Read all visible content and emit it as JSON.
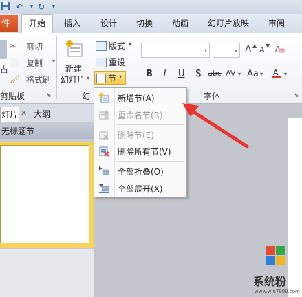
{
  "ribbon_tabs": [
    {
      "label": "件",
      "active": false
    },
    {
      "label": "开始",
      "active": true
    },
    {
      "label": "插入",
      "active": false
    },
    {
      "label": "设计",
      "active": false
    },
    {
      "label": "切换",
      "active": false
    },
    {
      "label": "动画",
      "active": false
    },
    {
      "label": "幻灯片放映",
      "active": false
    },
    {
      "label": "审阅",
      "active": false
    }
  ],
  "clipboard": {
    "cut": "剪切",
    "copy": "复制",
    "format_painter": "格式刷",
    "paste_fragment": "占",
    "group_label": "剪贴板"
  },
  "slides": {
    "new_slide_line1": "新建",
    "new_slide_line2": "幻灯片",
    "layout": "版式",
    "reset": "重设",
    "section": "节",
    "group_label_fragment": "幻"
  },
  "font": {
    "group_label": "字体",
    "bold": "B",
    "italic": "I",
    "underline": "U",
    "shadow": "S",
    "strike": "abc",
    "spacing": "AV",
    "case": "Aa",
    "grow": "A",
    "shrink": "A"
  },
  "panel": {
    "tab_slides": "灯片",
    "tab_outline": "大纲",
    "section_header": "无标题节"
  },
  "section_menu": {
    "items": [
      {
        "label": "新增节(A)",
        "enabled": true
      },
      {
        "label": "重命名节(R)",
        "enabled": false
      },
      {
        "label": "删除节(E)",
        "enabled": false
      },
      {
        "label": "删除所有节(V)",
        "enabled": true
      },
      {
        "label": "全部折叠(O)",
        "enabled": true
      },
      {
        "label": "全部展开(X)",
        "enabled": true
      }
    ]
  },
  "watermark": {
    "text": "系统粉",
    "url": "www.win7999.com"
  },
  "colors": {
    "accent_red": "#e8352f",
    "file_tab": "#d9531f",
    "highlight": "#f6d35e"
  }
}
